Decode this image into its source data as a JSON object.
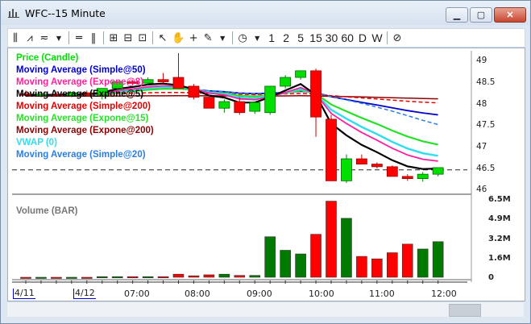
{
  "window": {
    "title": "WFC--15 Minute"
  },
  "window_controls": {
    "minimize": "▁",
    "maximize": "▢",
    "close": "✕"
  },
  "toolbar": {
    "interval_labels": [
      "1",
      "2",
      "5",
      "15",
      "30",
      "60",
      "D",
      "W"
    ]
  },
  "legend": [
    {
      "label": "Price (Candle)",
      "color": "#00e000"
    },
    {
      "label": "Moving Average (Simple@50)",
      "color": "#0000cc"
    },
    {
      "label": "Moving Average (Expone@8)",
      "color": "#ff1f9e"
    },
    {
      "label": "Moving Average (Expone@5)",
      "color": "#000000"
    },
    {
      "label": "Moving Average (Simple@200)",
      "color": "#e00000"
    },
    {
      "label": "Moving Average (Expone@15)",
      "color": "#28e028"
    },
    {
      "label": "Moving Average (Expone@200)",
      "color": "#8b0000"
    },
    {
      "label": "VWAP (0)",
      "color": "#33ddee"
    },
    {
      "label": "Moving Average (Simple@20)",
      "color": "#2b7fe0"
    }
  ],
  "price_axis": {
    "labels": [
      "49",
      "48.5",
      "48",
      "47.5",
      "47",
      "46.5",
      "46"
    ]
  },
  "volume_panel": {
    "title": "Volume (BAR)",
    "axis_labels": [
      "6.5M",
      "4.9M",
      "3.2M",
      "1.6M",
      "0"
    ]
  },
  "time_axis": {
    "labels": [
      "4/11",
      "4/12",
      "07:00",
      "08:00",
      "09:00",
      "10:00",
      "11:00",
      "12:00"
    ]
  },
  "chart_data": {
    "type": "candlestick",
    "ylim": [
      45.95,
      49.1
    ],
    "volume_ylim": [
      0,
      6.5
    ],
    "candles": [
      {
        "o": 48.18,
        "h": 48.25,
        "l": 48.12,
        "c": 48.15,
        "v": 0.0
      },
      {
        "o": 48.15,
        "h": 48.22,
        "l": 48.1,
        "c": 48.17,
        "v": 0.0
      },
      {
        "o": 48.17,
        "h": 48.23,
        "l": 48.12,
        "c": 48.14,
        "v": 0.0
      },
      {
        "o": 48.14,
        "h": 48.22,
        "l": 48.1,
        "c": 48.2,
        "v": 0.0
      },
      {
        "o": 48.2,
        "h": 48.25,
        "l": 48.12,
        "c": 48.15,
        "v": 0.0
      },
      {
        "o": 48.15,
        "h": 48.3,
        "l": 48.05,
        "c": 48.3,
        "v": 0.05
      },
      {
        "o": 48.3,
        "h": 48.45,
        "l": 48.25,
        "c": 48.45,
        "v": 0.05
      },
      {
        "o": 48.45,
        "h": 48.48,
        "l": 48.38,
        "c": 48.42,
        "v": 0.05
      },
      {
        "o": 48.42,
        "h": 48.55,
        "l": 48.38,
        "c": 48.5,
        "v": 0.05
      },
      {
        "o": 48.5,
        "h": 48.65,
        "l": 48.42,
        "c": 48.45,
        "v": 0.05
      },
      {
        "o": 48.55,
        "h": 49.1,
        "l": 48.45,
        "c": 48.3,
        "v": 0.25
      },
      {
        "o": 48.35,
        "h": 48.4,
        "l": 48.05,
        "c": 48.1,
        "v": 0.12
      },
      {
        "o": 48.1,
        "h": 48.15,
        "l": 47.9,
        "c": 47.85,
        "v": 0.2
      },
      {
        "o": 47.85,
        "h": 48.05,
        "l": 47.75,
        "c": 48.0,
        "v": 0.25
      },
      {
        "o": 48.0,
        "h": 48.1,
        "l": 47.7,
        "c": 47.75,
        "v": 0.15
      },
      {
        "o": 47.78,
        "h": 48.0,
        "l": 47.72,
        "c": 47.98,
        "v": 0.15
      },
      {
        "o": 47.75,
        "h": 48.35,
        "l": 47.7,
        "c": 48.35,
        "v": 3.3
      },
      {
        "o": 48.35,
        "h": 48.6,
        "l": 48.3,
        "c": 48.55,
        "v": 2.2
      },
      {
        "o": 48.55,
        "h": 48.7,
        "l": 48.5,
        "c": 48.7,
        "v": 1.9
      },
      {
        "o": 48.7,
        "h": 48.75,
        "l": 47.2,
        "c": 47.65,
        "v": 3.5
      },
      {
        "o": 47.6,
        "h": 47.7,
        "l": 46.2,
        "c": 46.2,
        "v": 6.2
      },
      {
        "o": 46.2,
        "h": 46.8,
        "l": 46.15,
        "c": 46.7,
        "v": 4.8
      },
      {
        "o": 46.7,
        "h": 46.8,
        "l": 46.58,
        "c": 46.58,
        "v": 1.7
      },
      {
        "o": 46.58,
        "h": 46.62,
        "l": 46.48,
        "c": 46.52,
        "v": 1.5
      },
      {
        "o": 46.52,
        "h": 46.55,
        "l": 46.3,
        "c": 46.3,
        "v": 2.0
      },
      {
        "o": 46.3,
        "h": 46.35,
        "l": 46.2,
        "c": 46.25,
        "v": 2.7
      },
      {
        "o": 46.25,
        "h": 46.4,
        "l": 46.18,
        "c": 46.35,
        "v": 2.3
      },
      {
        "o": 46.35,
        "h": 46.5,
        "l": 46.3,
        "c": 46.5,
        "v": 2.9
      }
    ]
  }
}
